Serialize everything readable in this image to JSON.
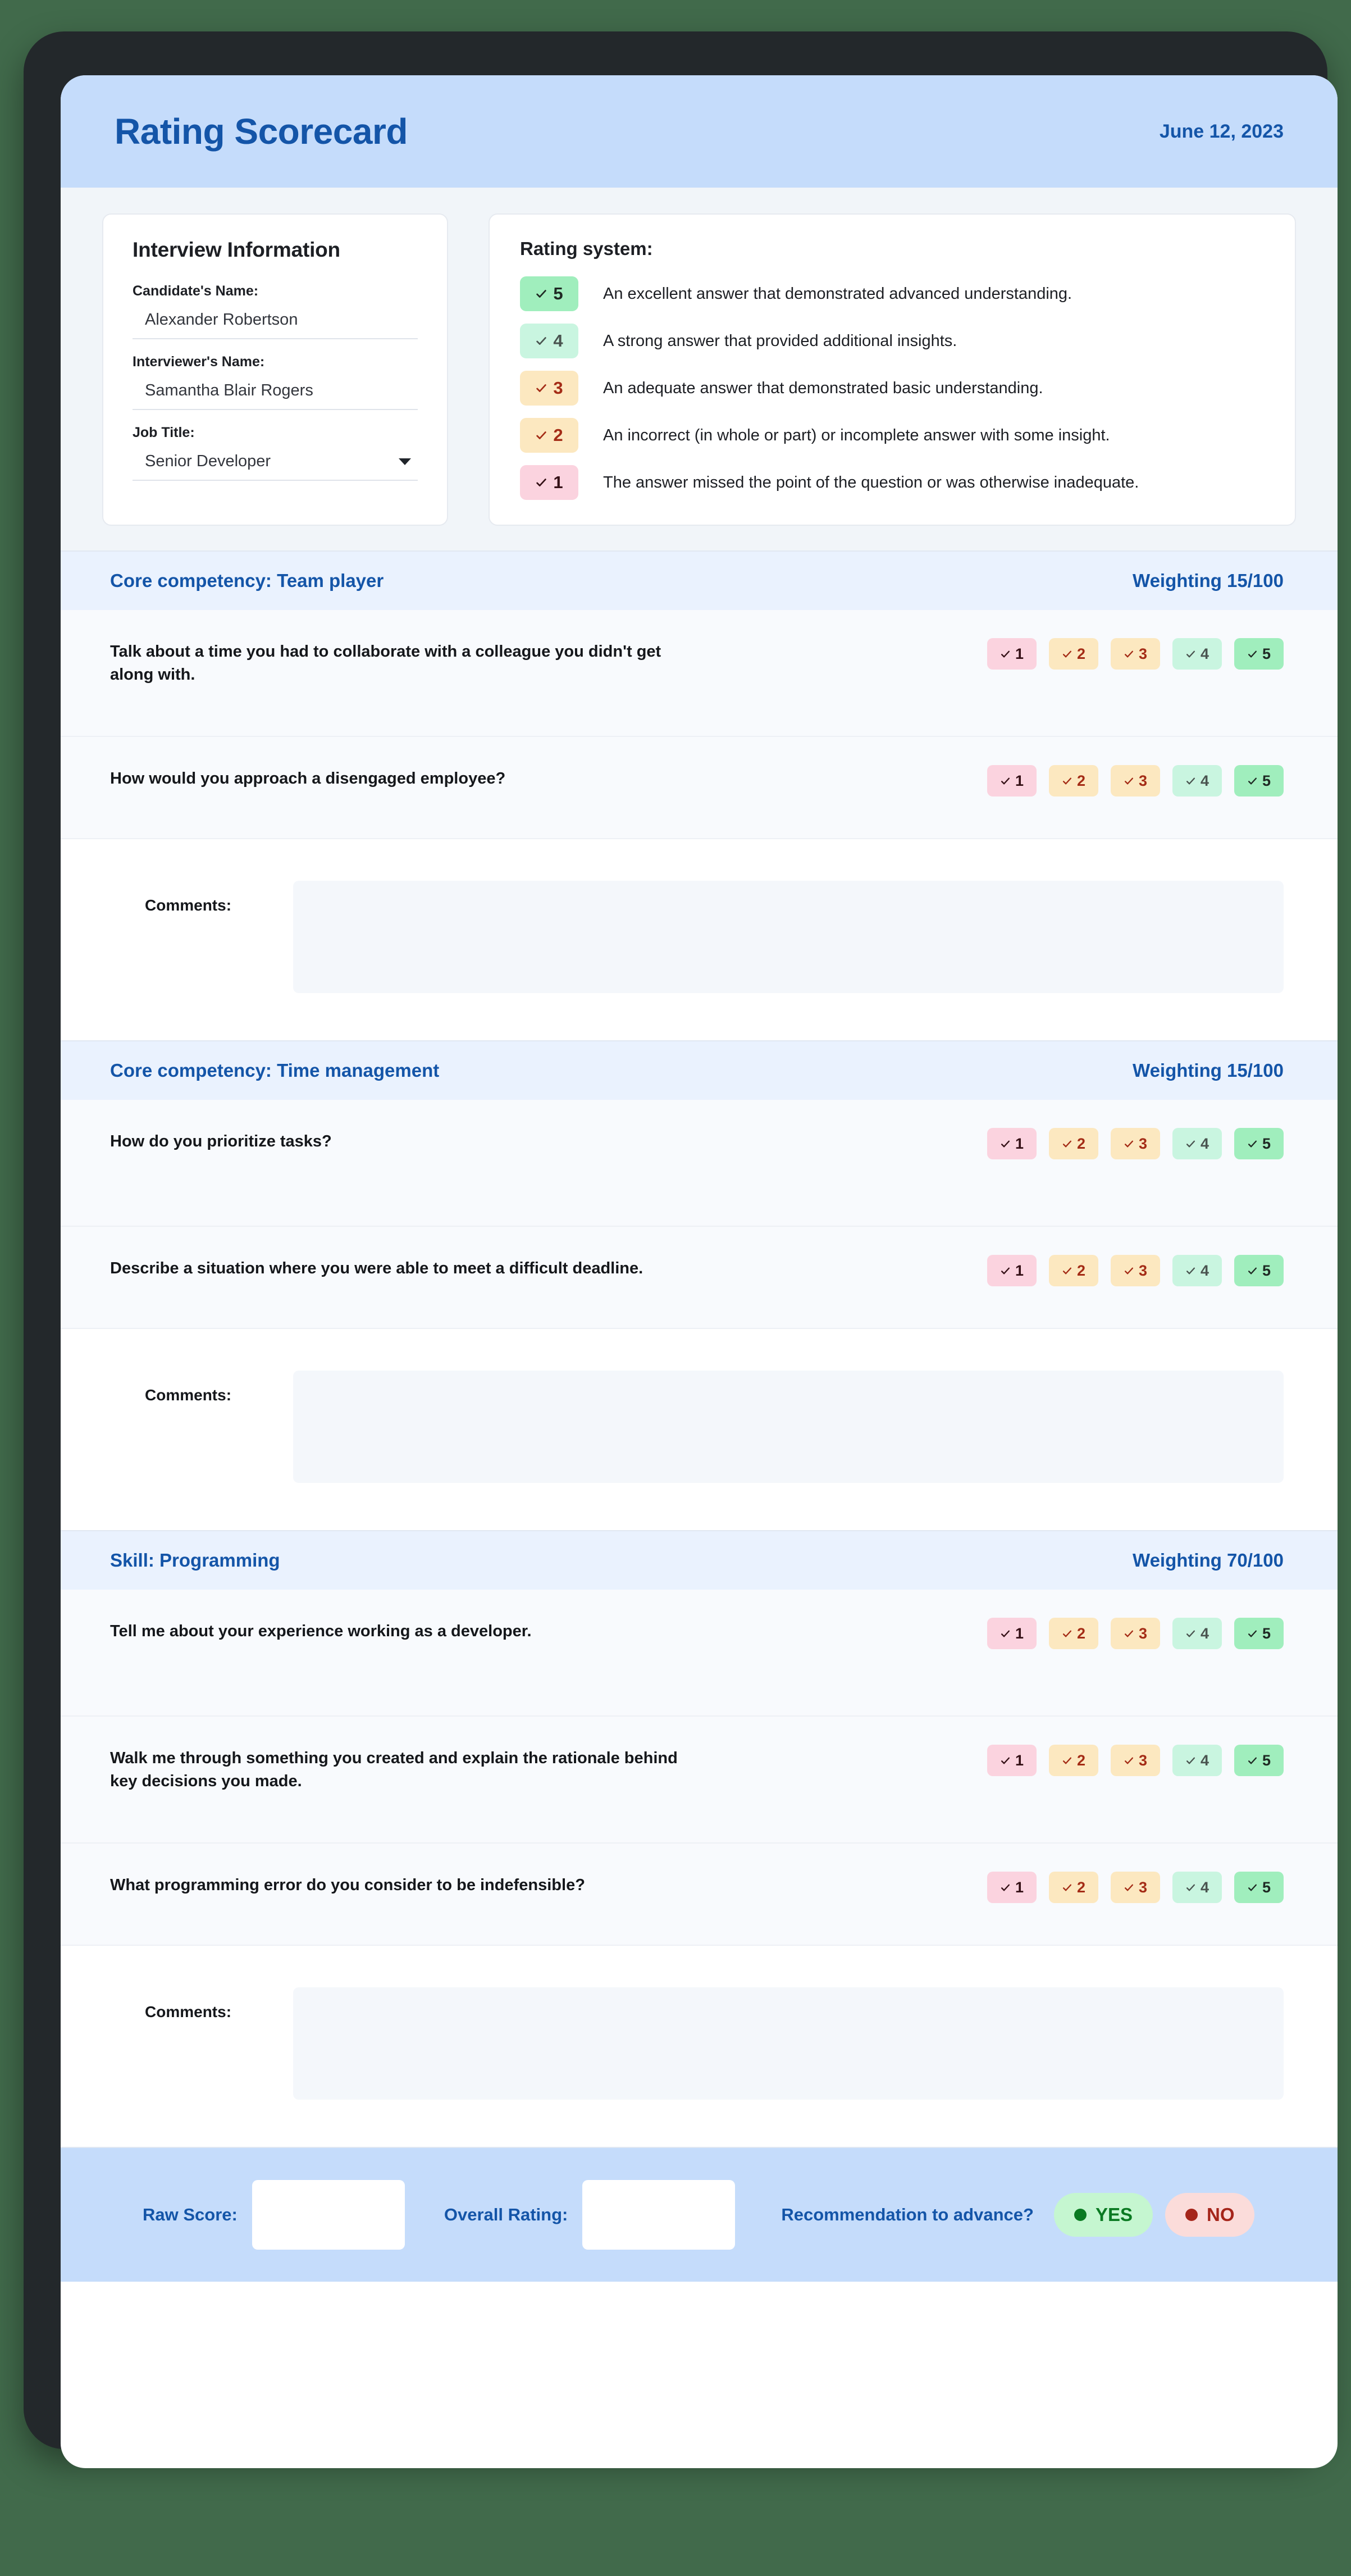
{
  "header": {
    "title": "Rating Scorecard",
    "date": "June 12, 2023"
  },
  "interview_info": {
    "title": "Interview Information",
    "fields": [
      {
        "label": "Candidate's Name:",
        "value": "Alexander Robertson",
        "type": "text"
      },
      {
        "label": "Interviewer's Name:",
        "value": "Samantha Blair Rogers",
        "type": "text"
      },
      {
        "label": "Job Title:",
        "value": "Senior Developer",
        "type": "select"
      }
    ]
  },
  "rating_system": {
    "title": "Rating system:",
    "items": [
      {
        "score": "5",
        "icon": "check-icon",
        "description": "An excellent answer that demonstrated advanced understanding."
      },
      {
        "score": "4",
        "icon": "check-icon",
        "description": "A strong answer that provided additional insights."
      },
      {
        "score": "3",
        "icon": "check-icon",
        "description": "An adequate answer that demonstrated basic understanding."
      },
      {
        "score": "2",
        "icon": "check-icon",
        "description": "An incorrect (in whole or part) or incomplete answer with some insight."
      },
      {
        "score": "1",
        "icon": "check-icon",
        "description": "The answer missed the point of the question or was otherwise inadequate."
      }
    ]
  },
  "scale": [
    "1",
    "2",
    "3",
    "4",
    "5"
  ],
  "sections": [
    {
      "title": "Core competency: Team player",
      "weighting": "Weighting 15/100",
      "questions": [
        "Talk about a time you had to collaborate with a colleague you didn't get along with.",
        "How would you approach a disengaged employee?"
      ],
      "comments_label": "Comments:",
      "comments_value": ""
    },
    {
      "title": "Core competency: Time management",
      "weighting": "Weighting 15/100",
      "questions": [
        "How do you prioritize tasks?",
        "Describe a situation where you were able to meet a difficult deadline."
      ],
      "comments_label": "Comments:",
      "comments_value": ""
    },
    {
      "title": "Skill: Programming",
      "weighting": "Weighting 70/100",
      "questions": [
        "Tell me about your experience working as a developer.",
        "Walk me through something you created and explain the rationale behind key decisions you made.",
        "What programming error do you consider to be indefensible?"
      ],
      "comments_label": "Comments:",
      "comments_value": ""
    }
  ],
  "footer": {
    "raw_score_label": "Raw Score:",
    "raw_score_value": "",
    "overall_rating_label": "Overall Rating:",
    "overall_rating_value": "",
    "recommendation_label": "Recommendation to advance?",
    "yes_label": "YES",
    "no_label": "NO"
  },
  "colors": {
    "background": "#416a4b",
    "frame": "#23282b",
    "header_bg": "#c5dcfb",
    "accent_blue": "#1455a8",
    "section_head_bg": "#eaf2fe",
    "row_bg": "#f8fafd",
    "chip_5": "#a0eebd",
    "chip_4": "#c9f5e0",
    "chip_3": "#fce8c0",
    "chip_2": "#fce8c0",
    "chip_1": "#fbd3df",
    "yes_bg": "#c5f6d0",
    "no_bg": "#fbdcda"
  }
}
